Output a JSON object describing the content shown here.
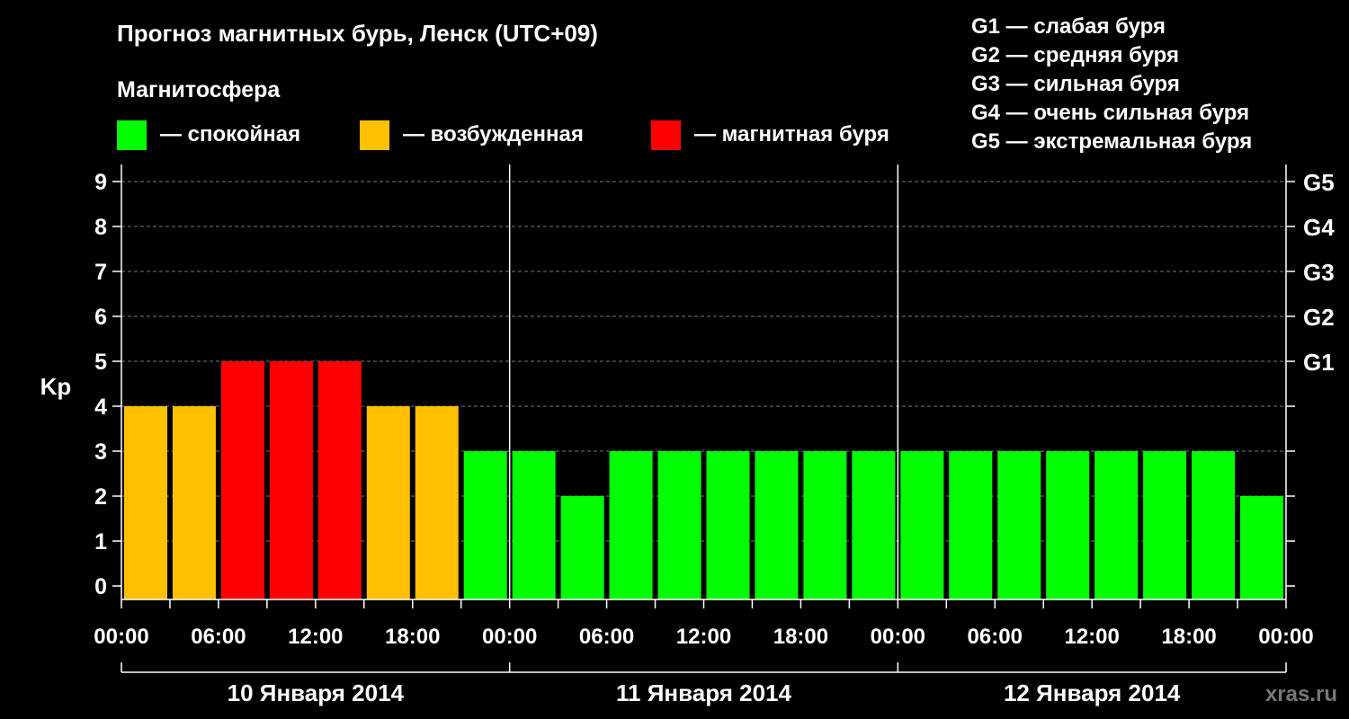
{
  "title": "Прогноз магнитных бурь, Ленск (UTC+09)",
  "subtitle": "Магнитосфера",
  "legend": [
    {
      "label": "— спокойная",
      "color": "#00ff00"
    },
    {
      "label": "— возбужденная",
      "color": "#ffc000"
    },
    {
      "label": "— магнитная буря",
      "color": "#ff0000"
    }
  ],
  "g_legend": [
    "G1 — слабая буря",
    "G2 — средняя буря",
    "G3 — сильная буря",
    "G4 — очень сильная буря",
    "G5 — экстремальная буря"
  ],
  "watermark": "xras.ru",
  "chart_data": {
    "type": "bar",
    "ylabel": "Kp",
    "ylim": [
      0,
      9
    ],
    "yticks": [
      "0",
      "1",
      "2",
      "3",
      "4",
      "5",
      "6",
      "7",
      "8",
      "9"
    ],
    "g_levels": [
      {
        "label": "G1",
        "kp": 5
      },
      {
        "label": "G2",
        "kp": 6
      },
      {
        "label": "G3",
        "kp": 7
      },
      {
        "label": "G4",
        "kp": 8
      },
      {
        "label": "G5",
        "kp": 9
      }
    ],
    "xtick_labels": [
      "00:00",
      "06:00",
      "12:00",
      "18:00",
      "00:00",
      "06:00",
      "12:00",
      "18:00",
      "00:00",
      "06:00",
      "12:00",
      "18:00",
      "00:00"
    ],
    "days": [
      "10 Января 2014",
      "11 Января 2014",
      "12 Января 2014"
    ],
    "interval_hours": 3,
    "values": [
      4,
      4,
      5,
      5,
      5,
      4,
      4,
      3,
      3,
      2,
      3,
      3,
      3,
      3,
      3,
      3,
      3,
      3,
      3,
      3,
      3,
      3,
      3,
      2
    ],
    "colors": {
      "quiet": "#00ff00",
      "active": "#ffc000",
      "storm": "#ff0000"
    },
    "grid": "dashed horizontal"
  }
}
